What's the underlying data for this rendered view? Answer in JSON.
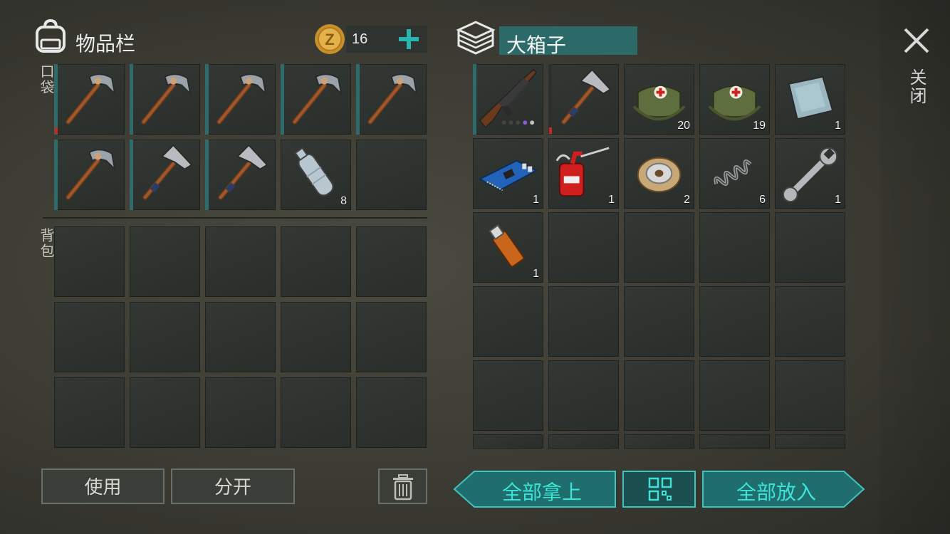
{
  "inventory": {
    "title": "物品栏",
    "coins": "16",
    "pocket_label": "口袋",
    "backpack_label": "背包",
    "pocket_slots": [
      {
        "item": "pickaxe",
        "count": ""
      },
      {
        "item": "pickaxe",
        "count": ""
      },
      {
        "item": "pickaxe",
        "count": ""
      },
      {
        "item": "pickaxe",
        "count": ""
      },
      {
        "item": "pickaxe",
        "count": ""
      },
      {
        "item": "pickaxe",
        "count": ""
      },
      {
        "item": "hammer",
        "count": ""
      },
      {
        "item": "hammer",
        "count": ""
      },
      {
        "item": "plastic-bottle",
        "count": "8"
      },
      {
        "item": "",
        "count": ""
      }
    ],
    "use_label": "使用",
    "split_label": "分开"
  },
  "container": {
    "title": "大箱子",
    "slots": [
      {
        "item": "ak-rifle",
        "count": ""
      },
      {
        "item": "hammer",
        "count": ""
      },
      {
        "item": "medical-bag",
        "count": "20"
      },
      {
        "item": "medical-bag",
        "count": "19"
      },
      {
        "item": "metal-plate",
        "count": "1"
      },
      {
        "item": "circuit-board",
        "count": "1"
      },
      {
        "item": "oil-can",
        "count": "1"
      },
      {
        "item": "wire-spool",
        "count": "2"
      },
      {
        "item": "spring",
        "count": "6"
      },
      {
        "item": "wrench",
        "count": "1"
      },
      {
        "item": "usb-drive",
        "count": "1"
      }
    ],
    "take_all_label": "全部拿上",
    "put_all_label": "全部放入"
  },
  "close_label": "关闭",
  "icons": {
    "backpack": "backpack-icon",
    "coin": "coin-icon",
    "add": "plus-icon",
    "box": "box-icon",
    "close": "close-icon",
    "trash": "trash-icon",
    "sort": "sort-grid-icon"
  },
  "colors": {
    "accent_teal": "#1f6e6d",
    "teal_text": "#3ee3d8",
    "plus": "#27b7b0",
    "coin": "#d9a233"
  }
}
